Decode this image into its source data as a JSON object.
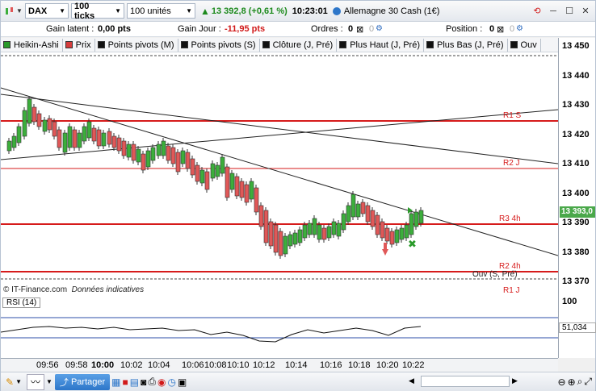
{
  "toolbar": {
    "instrument": "DAX",
    "interval": "100 ticks",
    "units": "100 unités",
    "price_change": "13 392,8 (+0,61 %)",
    "time": "10:23:01",
    "market": "Allemagne 30 Cash (1€)"
  },
  "info": {
    "latent_label": "Gain latent :",
    "latent_value": "0,00 pts",
    "day_label": "Gain Jour :",
    "day_value": "-11,95 pts",
    "orders_label": "Ordres :",
    "orders_value": "0",
    "position_label": "Position :",
    "position_value": "0"
  },
  "indicators": [
    {
      "label": "Heikin-Ashi",
      "color": "#2a9a2a"
    },
    {
      "label": "Prix",
      "color": "#d63c3c"
    },
    {
      "label": "Points pivots (M)",
      "color": "#111111"
    },
    {
      "label": "Points pivots (S)",
      "color": "#111111"
    },
    {
      "label": "Clôture (J, Pré)",
      "color": "#111111"
    },
    {
      "label": "Plus Haut (J, Pré)",
      "color": "#111111"
    },
    {
      "label": "Plus Bas (J, Pré)",
      "color": "#111111"
    },
    {
      "label": "Ouv",
      "color": "#111111"
    }
  ],
  "yaxis": [
    "13 450",
    "13 440",
    "13 430",
    "13 420",
    "13 410",
    "13 400",
    "13 390",
    "13 380",
    "13 370"
  ],
  "current_price": "13 393,0",
  "levels": {
    "r1s": "R1 S",
    "r2j": "R2 J",
    "r34h": "R3 4h",
    "r24h": "R2 4h",
    "ouv": "Ouv (S, Pré)",
    "r1j": "R1 J"
  },
  "source": "© IT-Finance.com",
  "source_note": "Données indicatives",
  "rsi": {
    "label": "RSI (14)",
    "axis": "100",
    "value": "51,034"
  },
  "xaxis": [
    "09:56",
    "09:58",
    "10:00",
    "10:02",
    "10:04",
    "10:06",
    "10:08",
    "10:10",
    "10:12",
    "10:14",
    "10:16",
    "10:18",
    "10:20",
    "10:22"
  ],
  "bottom": {
    "share": "Partager"
  },
  "colors": {
    "up": "#3cae3c",
    "down": "#e05858",
    "resistance": "#d61b1b",
    "price_tag": "#4aa84a"
  }
}
